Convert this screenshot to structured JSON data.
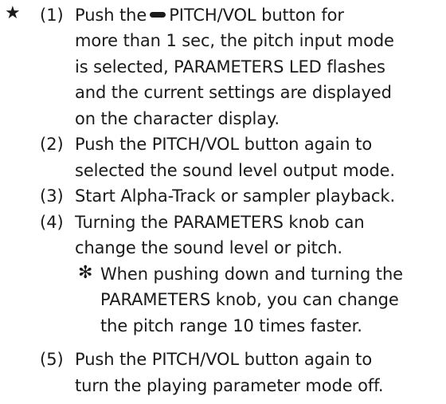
{
  "bullet": "★",
  "note_marker": "✻",
  "steps": [
    {
      "num": "(1)",
      "lines": [
        "Push the",
        "PITCH/VOL button for",
        "more than 1 sec, the pitch input mode",
        "is selected, PARAMETERS LED flashes",
        "and the current settings are displayed",
        "on the character display."
      ]
    },
    {
      "num": "(2)",
      "lines": [
        "Push the PITCH/VOL button again to",
        "selected the sound level output mode."
      ]
    },
    {
      "num": "(3)",
      "lines": [
        "Start Alpha-Track or sampler playback."
      ]
    },
    {
      "num": "(4)",
      "lines": [
        "Turning the PARAMETERS knob can",
        "change the sound level or pitch."
      ]
    },
    {
      "num": "(5)",
      "lines": [
        "Push the PITCH/VOL button again to",
        "turn the playing parameter mode off."
      ]
    }
  ],
  "note": {
    "lines": [
      "When pushing down and turning the",
      "PARAMETERS knob, you can change",
      "the pitch range 10 times faster."
    ]
  }
}
